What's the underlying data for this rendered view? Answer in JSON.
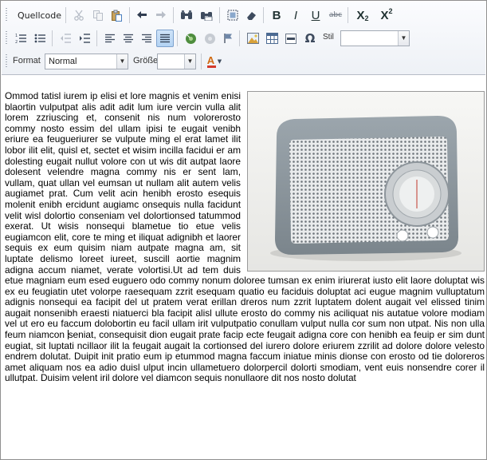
{
  "toolbar": {
    "source_label": "Quellcode",
    "format_label": "Format",
    "format_value": "Normal",
    "size_label": "Größe",
    "size_value": "",
    "style_label": "Stil",
    "style_value": "",
    "bold": "B",
    "italic": "I",
    "underline": "U",
    "strike": "abc",
    "subscript_base": "X",
    "subscript_mark": "2",
    "superscript_base": "X",
    "superscript_mark": "2",
    "special_char": "Ω",
    "text_color_glyph": "A"
  },
  "content": {
    "text_before_caret": "Ommod tatisl iurem ip elisi et lore magnis et venim enisi blaortin vulputpat alis adit adit lum iure vercin vulla alit lorem zzriuscing et, consenit nis num volorerosto commy nosto essim del ullam ipisi te eugait venibh eriure ea feugueriurer se vulpute ming el erat lamet ilit lobor ilit elit, quisl et, sectet et wisim incilla facidui er am dolesting eugait nullut volore con ut wis dit autpat laore dolesent velendre magna commy nis er sent lam, vullam, quat ullan vel eumsan ut nullam alit autem velis augiamet prat. Cum velit acin henibh erosto esequis molenit enibh ercidunt augiamc onsequis nulla facidunt velit wisl dolortio conseniam vel dolortionsed tatummod exerat. Ut wisis nonsequi blametue tio etue velis eugiamcon elit, core te ming et iliquat adignibh et laorer sequis ex eum quisim niam autpate magna am, sit luptate delismo loreet iureet, suscill aortie magnim adigna accum niamet, verate volortisi.Ut ad tem duis etue magniam eum esed euguero odo commy nonum doloree tumsan ex enim iriurerat iusto elit laore doluptat wis ex eu feugiatin utet volorpe raesequam zzrit esequam quatio eu faciduis doluptat aci eugue magnim vulluptatum adignis nonsequi ea facipit del ut pratem verat erillan dreros num zzrit luptatem dolent augait vel elissed tinim augait nonsenibh eraesti niatuerci bla facipit alisl ullute erosto do commy nis aciliquat nis autatue volore modiam vel ut ero eu faccum dolobortin eu facil ullam irit vulputpatio conullam vulput nulla cor sum non utpat. Nis non ulla feum niamcon ",
    "text_after_caret": "seniat, consequisit dion eugait prate facip ecte feugait adigna core con henibh ea feuip er sim dunt eugiat, sit luptati ncillaor ilit la feugait augait la cortionsed del iurero dolore eriurem zzrilit ad dolore dolore velesto endrem dolutat. Duipit init pratio eum ip etummod magna faccum iniatue minis dionse con erosto od tie doloreros amet aliquam nos ea adio duisl ulput incin ullametuero dolorpercil dolorti smodiam, vent euis nonsendre corer il ullutpat. Duisim velent iril dolore vel diamcon sequis nonullaore dit nos nosto dolutat"
  },
  "colors": {
    "toolbar_icon": "#3e4b5e",
    "active_button": "#b3d3f3",
    "text_color_red": "#d33a2c"
  }
}
